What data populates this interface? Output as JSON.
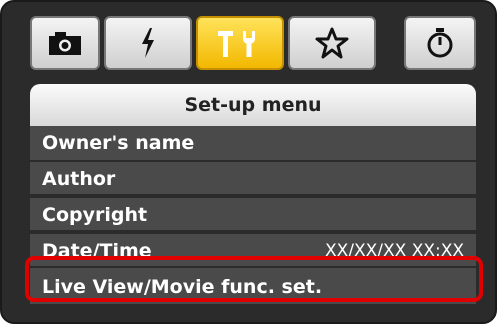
{
  "tabs": [
    {
      "icon": "camera-icon"
    },
    {
      "icon": "flash-icon"
    },
    {
      "icon": "wrench-icon",
      "active": true
    },
    {
      "icon": "star-icon"
    },
    {
      "icon": "timer-icon"
    }
  ],
  "colors": {
    "active_tab": "#f2b800",
    "row_bg": "#4a4a4a",
    "highlight_border": "#e00000"
  },
  "menu": {
    "title": "Set-up menu",
    "items": [
      {
        "label": "Owner's name",
        "value": ""
      },
      {
        "label": "Author",
        "value": ""
      },
      {
        "label": "Copyright",
        "value": ""
      },
      {
        "label": "Date/Time",
        "value": "XX/XX/XX XX:XX"
      },
      {
        "label": "Live View/Movie func. set.",
        "value": ""
      }
    ]
  }
}
